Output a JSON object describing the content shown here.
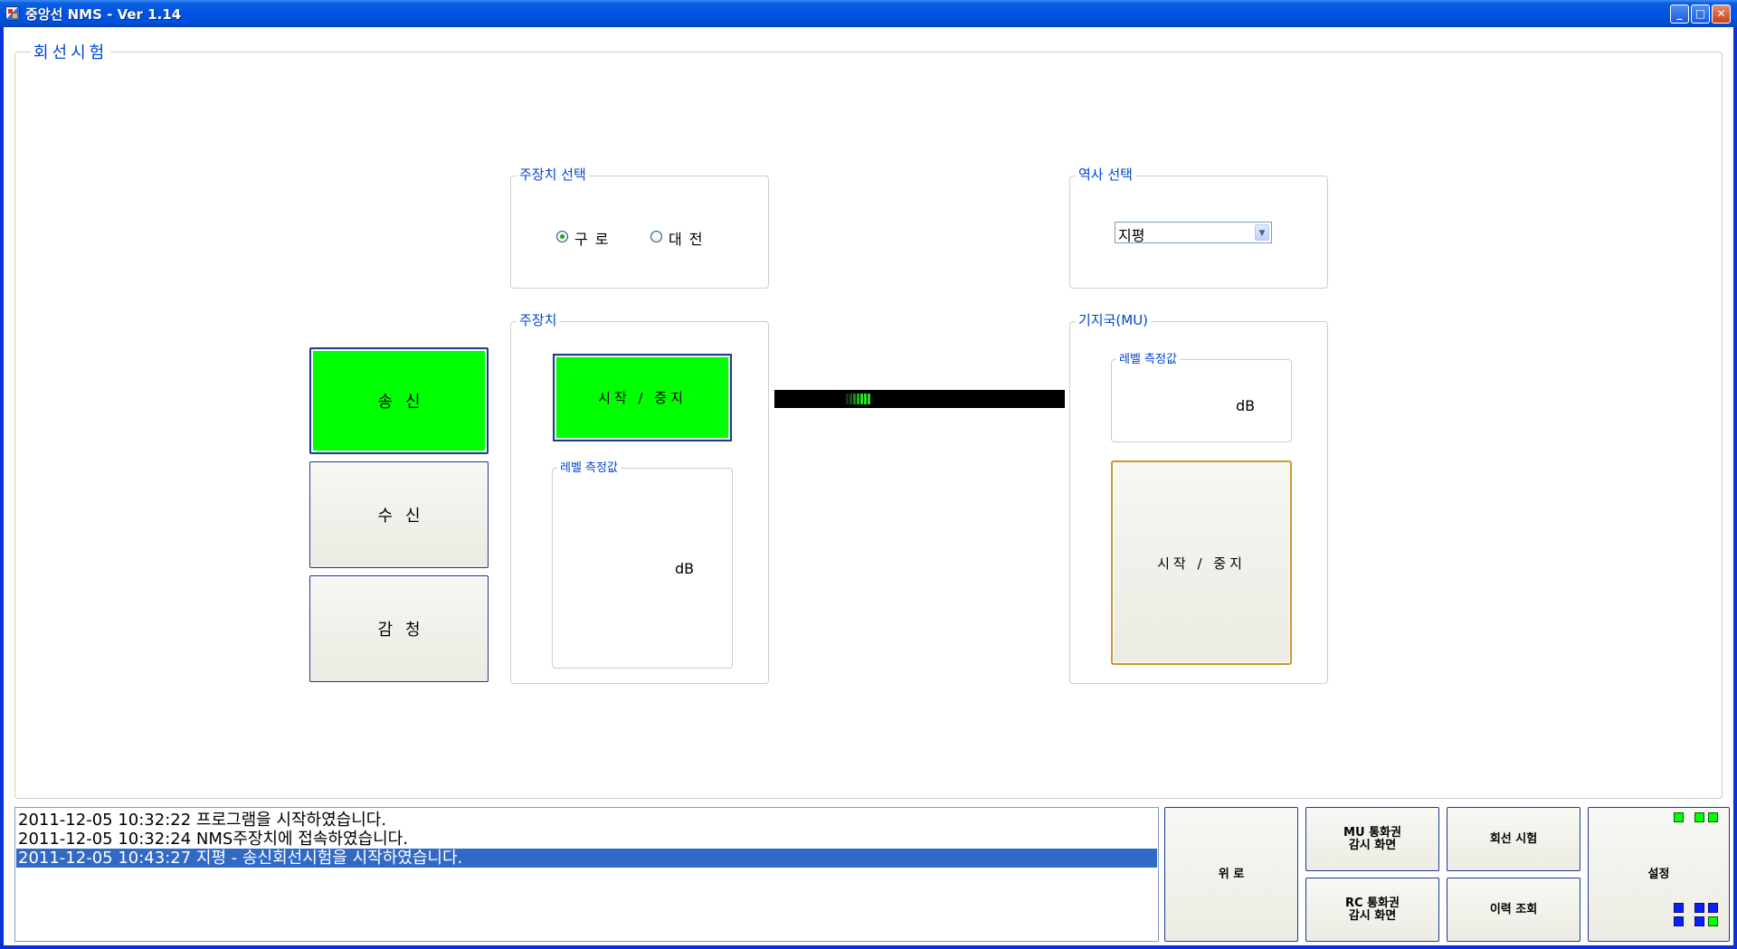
{
  "window": {
    "title": "중앙선 NMS  - Ver 1.14",
    "controls": [
      "minimize",
      "maximize",
      "close"
    ]
  },
  "main_group": {
    "legend": "회선시험"
  },
  "side_buttons": [
    {
      "label": "송신",
      "active": true
    },
    {
      "label": "수신",
      "active": false
    },
    {
      "label": "감청",
      "active": false
    }
  ],
  "device_select": {
    "legend": "주장치 선택",
    "options": [
      {
        "label": "구로",
        "checked": true
      },
      {
        "label": "대전",
        "checked": false
      }
    ]
  },
  "station_select": {
    "legend": "역사 선택",
    "selected": "지평"
  },
  "main_device": {
    "legend": "주장치",
    "start_stop_label": "시작 / 중지",
    "level_legend": "레벨 측정값",
    "unit": "dB"
  },
  "base_station": {
    "legend": "기지국(MU)",
    "level_legend": "레벨 측정값",
    "unit": "dB",
    "start_stop_label": "시작 / 중지"
  },
  "log": {
    "entries": [
      {
        "text": "2011-12-05 10:32:22 프로그램을 시작하였습니다.",
        "selected": false
      },
      {
        "text": "2011-12-05 10:32:24 NMS주장치에 접속하였습니다.",
        "selected": false
      },
      {
        "text": "2011-12-05 10:43:27 지평 - 송신회선시험을 시작하였습니다.",
        "selected": true
      }
    ]
  },
  "nav": {
    "home": "위 로",
    "mu_monitor_1": "MU 통화권",
    "mu_monitor_2": "감시 화면",
    "rc_monitor_1": "RC 통화권",
    "rc_monitor_2": "감시 화면",
    "line_test": "회선 시험",
    "history": "이력 조회",
    "settings": "설정"
  },
  "colors": {
    "active_green": "#00ff00",
    "legend_blue": "#0046d5",
    "selection_blue": "#316ac5",
    "titlebar_blue": "#0054e3"
  }
}
